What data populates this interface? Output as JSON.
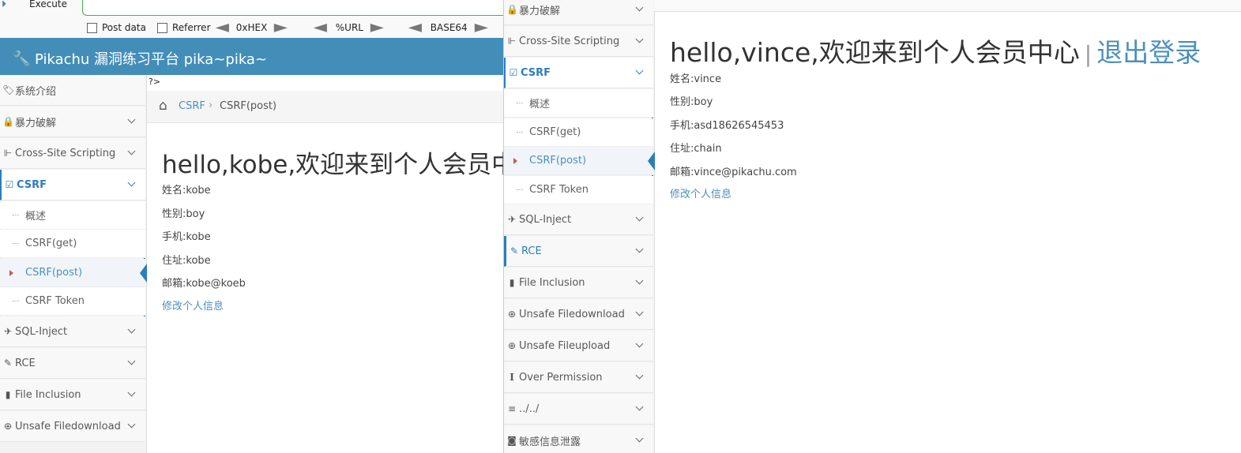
{
  "hackbar": {
    "execute_label": "Execute",
    "post_data_label": "Post data",
    "referrer_label": "Referrer",
    "hex_label": "0xHEX",
    "url_label": "%URL",
    "base64_label": "BASE64"
  },
  "brand": "Pikachu 漏洞练习平台 pika~pika~",
  "php_tag": "?>",
  "left_sidebar": {
    "intro": "系统介绍",
    "brute": "暴力破解",
    "xss": "Cross-Site Scripting",
    "csrf": "CSRF",
    "csrf_sub": [
      "概述",
      "CSRF(get)",
      "CSRF(post)",
      "CSRF Token"
    ],
    "sqli": "SQL-Inject",
    "rce": "RCE",
    "file_inclusion": "File Inclusion",
    "unsafe_download": "Unsafe Filedownload"
  },
  "breadcrumb": {
    "link": "CSRF",
    "separator": "›",
    "current": "CSRF(post)"
  },
  "left_main": {
    "welcome": "hello,kobe,欢迎来到个人会员中",
    "name": "姓名:kobe",
    "sex": "性别:boy",
    "phone": "手机:kobe",
    "address": "住址:kobe",
    "email": "邮箱:kobe@koeb",
    "edit_link": "修改个人信息"
  },
  "right_sidebar": {
    "brute": "暴力破解",
    "xss": "Cross-Site Scripting",
    "csrf": "CSRF",
    "csrf_sub": [
      "概述",
      "CSRF(get)",
      "CSRF(post)",
      "CSRF Token"
    ],
    "sqli": "SQL-Inject",
    "rce": "RCE",
    "file_inclusion": "File Inclusion",
    "unsafe_download": "Unsafe Filedownload",
    "unsafe_upload": "Unsafe Fileupload",
    "over_permission": "Over Permission",
    "dir_traversal": "../../",
    "info_leak": "敏感信息泄露"
  },
  "right_main": {
    "welcome": "hello,vince,欢迎来到个人会员中心",
    "separator": "|",
    "logout": "退出登录",
    "name": "姓名:vince",
    "sex": "性别:boy",
    "phone": "手机:asd18626545453",
    "address": "住址:chain",
    "email": "邮箱:vince@pikachu.com",
    "edit_link": "修改个人信息"
  },
  "colors": {
    "topbar": "#438eb9",
    "accent": "#2b7dbc",
    "link": "#4c8fbd"
  },
  "icons": [
    "execute-icon",
    "key-icon",
    "tag-icon",
    "lock-icon",
    "xss-icon",
    "edit-icon",
    "plane-icon",
    "pencil-icon",
    "file-icon",
    "download-icon",
    "upload-icon",
    "text-icon",
    "list-icon",
    "camera-icon",
    "home-icon",
    "chevron-down-icon"
  ]
}
